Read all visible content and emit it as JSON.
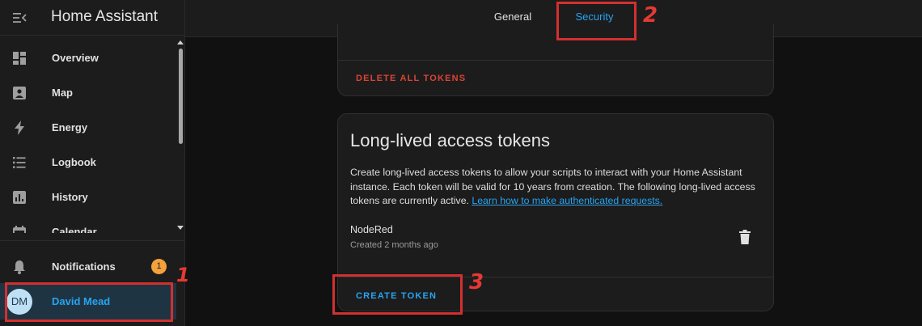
{
  "app": {
    "title": "Home Assistant"
  },
  "sidebar": {
    "items": [
      {
        "label": "Overview",
        "icon": "overview-icon"
      },
      {
        "label": "Map",
        "icon": "map-icon"
      },
      {
        "label": "Energy",
        "icon": "energy-icon"
      },
      {
        "label": "Logbook",
        "icon": "logbook-icon"
      },
      {
        "label": "History",
        "icon": "history-icon"
      },
      {
        "label": "Calendar",
        "icon": "calendar-icon"
      }
    ],
    "notifications": {
      "label": "Notifications",
      "count": "1"
    },
    "user": {
      "name": "David Mead",
      "initials": "DM"
    }
  },
  "tabs": [
    {
      "label": "General"
    },
    {
      "label": "Security"
    }
  ],
  "refresh_tokens_card": {
    "delete_all_label": "DELETE ALL TOKENS"
  },
  "long_lived_card": {
    "title": "Long-lived access tokens",
    "description": "Create long-lived access tokens to allow your scripts to interact with your Home Assistant instance. Each token will be valid for 10 years from creation. The following long-lived access tokens are currently active. ",
    "link_text": "Learn how to make authenticated requests.",
    "tokens": [
      {
        "name": "NodeRed",
        "created": "Created 2 months ago"
      }
    ],
    "create_label": "CREATE TOKEN"
  },
  "annotations": [
    "1",
    "2",
    "3"
  ],
  "colors": {
    "accent": "#27a4f2",
    "danger": "#db4437",
    "badge": "#f3a13a",
    "annotation": "#d32f2f"
  }
}
